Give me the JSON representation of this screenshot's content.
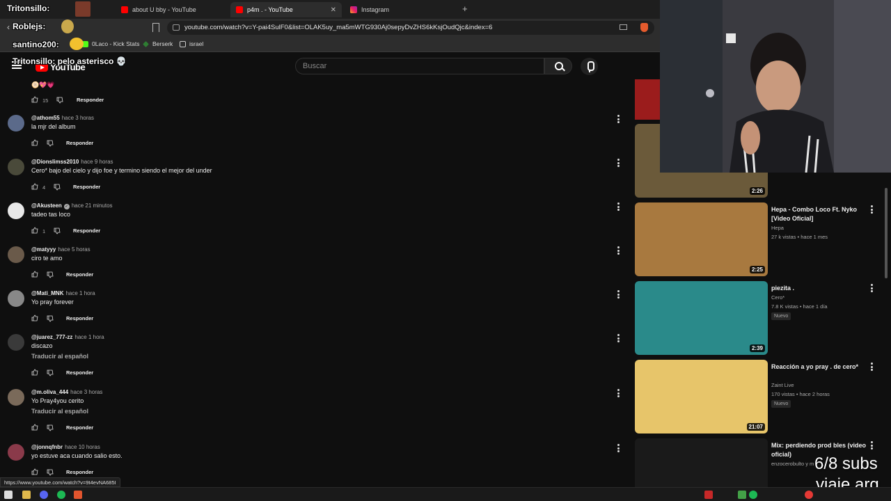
{
  "browser": {
    "tabs": [
      {
        "label": "about U bby - YouTube"
      },
      {
        "label": "p4m . - YouTube"
      },
      {
        "label": "Instagram"
      }
    ],
    "new_tab": "+",
    "url": "youtube.com/watch?v=Y-pai4SulF0&list=OLAK5uy_ma5mWTG930Aj0sepyDvZHS6kKsjOudQjc&index=6",
    "bookmarks": [
      {
        "label": "0Laco - Kick Stats"
      },
      {
        "label": "Berserk"
      },
      {
        "label": "israel"
      }
    ],
    "status_url": "https://www.youtube.com/watch?v=9t4evNA685I"
  },
  "youtube": {
    "logo_text": "YouTube",
    "search_placeholder": "Buscar"
  },
  "chat_overlays": [
    {
      "text": "Tritonsillo:"
    },
    {
      "text": "Roblejs:"
    },
    {
      "text": "santino200:"
    },
    {
      "text": "Tritonsillo: pelo asterisco 💀"
    }
  ],
  "first_comment": {
    "emojis": "🫓💖💗",
    "likes": "15",
    "reply": "Responder"
  },
  "comments": [
    {
      "author": "@athom55",
      "time": "hace 3 horas",
      "text": "la mjr del album",
      "likes": "",
      "translate": "",
      "verified": false,
      "avatar_color": "#5b6a8a"
    },
    {
      "author": "@Dionslimss2010",
      "time": "hace 9 horas",
      "text": "Cero* bajo del cielo y dijo foe  y termino siendo el mejor del under",
      "likes": "4",
      "translate": "",
      "verified": false,
      "avatar_color": "#4a4a3a"
    },
    {
      "author": "@Akusteen",
      "time": "hace 21 minutos",
      "text": "tadeo tas loco",
      "likes": "1",
      "translate": "",
      "verified": true,
      "avatar_color": "#e8e8e8"
    },
    {
      "author": "@matyyy",
      "time": "hace 5 horas",
      "text": "ciro te amo",
      "likes": "",
      "translate": "",
      "verified": false,
      "avatar_color": "#6a5a4a"
    },
    {
      "author": "@Mati_MNK",
      "time": "hace 1 hora",
      "text": "Yo pray forever",
      "likes": "",
      "translate": "",
      "verified": false,
      "avatar_color": "#888"
    },
    {
      "author": "@juarez_777-zz",
      "time": "hace 1 hora",
      "text": "discazo",
      "likes": "",
      "translate": "Traducir al español",
      "verified": false,
      "avatar_color": "#3a3a3a"
    },
    {
      "author": "@m.oliva_444",
      "time": "hace 3 horas",
      "text": "Yo Pray4you cerito",
      "likes": "",
      "translate": "Traducir al español",
      "verified": false,
      "avatar_color": "#7a6a5a"
    },
    {
      "author": "@jonnqfnbr",
      "time": "hace 10 horas",
      "text": "yo estuve aca cuando salio esto.",
      "likes": "",
      "translate": "",
      "verified": false,
      "avatar_color": "#8a3a4a"
    }
  ],
  "reply_label": "Responder",
  "related": [
    {
      "title": "",
      "channel": "",
      "views": "",
      "age": "",
      "duration": "2:26",
      "badge": "",
      "thumb_color": "#6b5a3a"
    },
    {
      "title": "Hepa - Combo Loco Ft. Nyko [Video Oficial]",
      "channel": "Hepa",
      "views": "27 k vistas",
      "age": "hace 1 mes",
      "duration": "2:25",
      "badge": "",
      "thumb_color": "#a8793f"
    },
    {
      "title": "piezita .",
      "channel": "Cero*",
      "views": "7.8 K vistas",
      "age": "hace 1 día",
      "duration": "2:39",
      "badge": "Nuevo",
      "thumb_color": "#2a8a8a"
    },
    {
      "title": "Reacción a yo pray .  de cero*",
      "channel": "Zaint Live",
      "views": "170 vistas",
      "age": "hace 2 horas",
      "duration": "21:07",
      "badge": "Nuevo",
      "thumb_color": "#e7c56a"
    },
    {
      "title": "Mix: perdiendo prod bles (video oficial)",
      "channel": "enzocerobulto y m",
      "views": "",
      "age": "",
      "duration": "",
      "badge": "",
      "thumb_color": "#1a1a1a"
    }
  ],
  "stream_overlay": {
    "subs": "6/8 subs",
    "trip": "viaje arg"
  }
}
